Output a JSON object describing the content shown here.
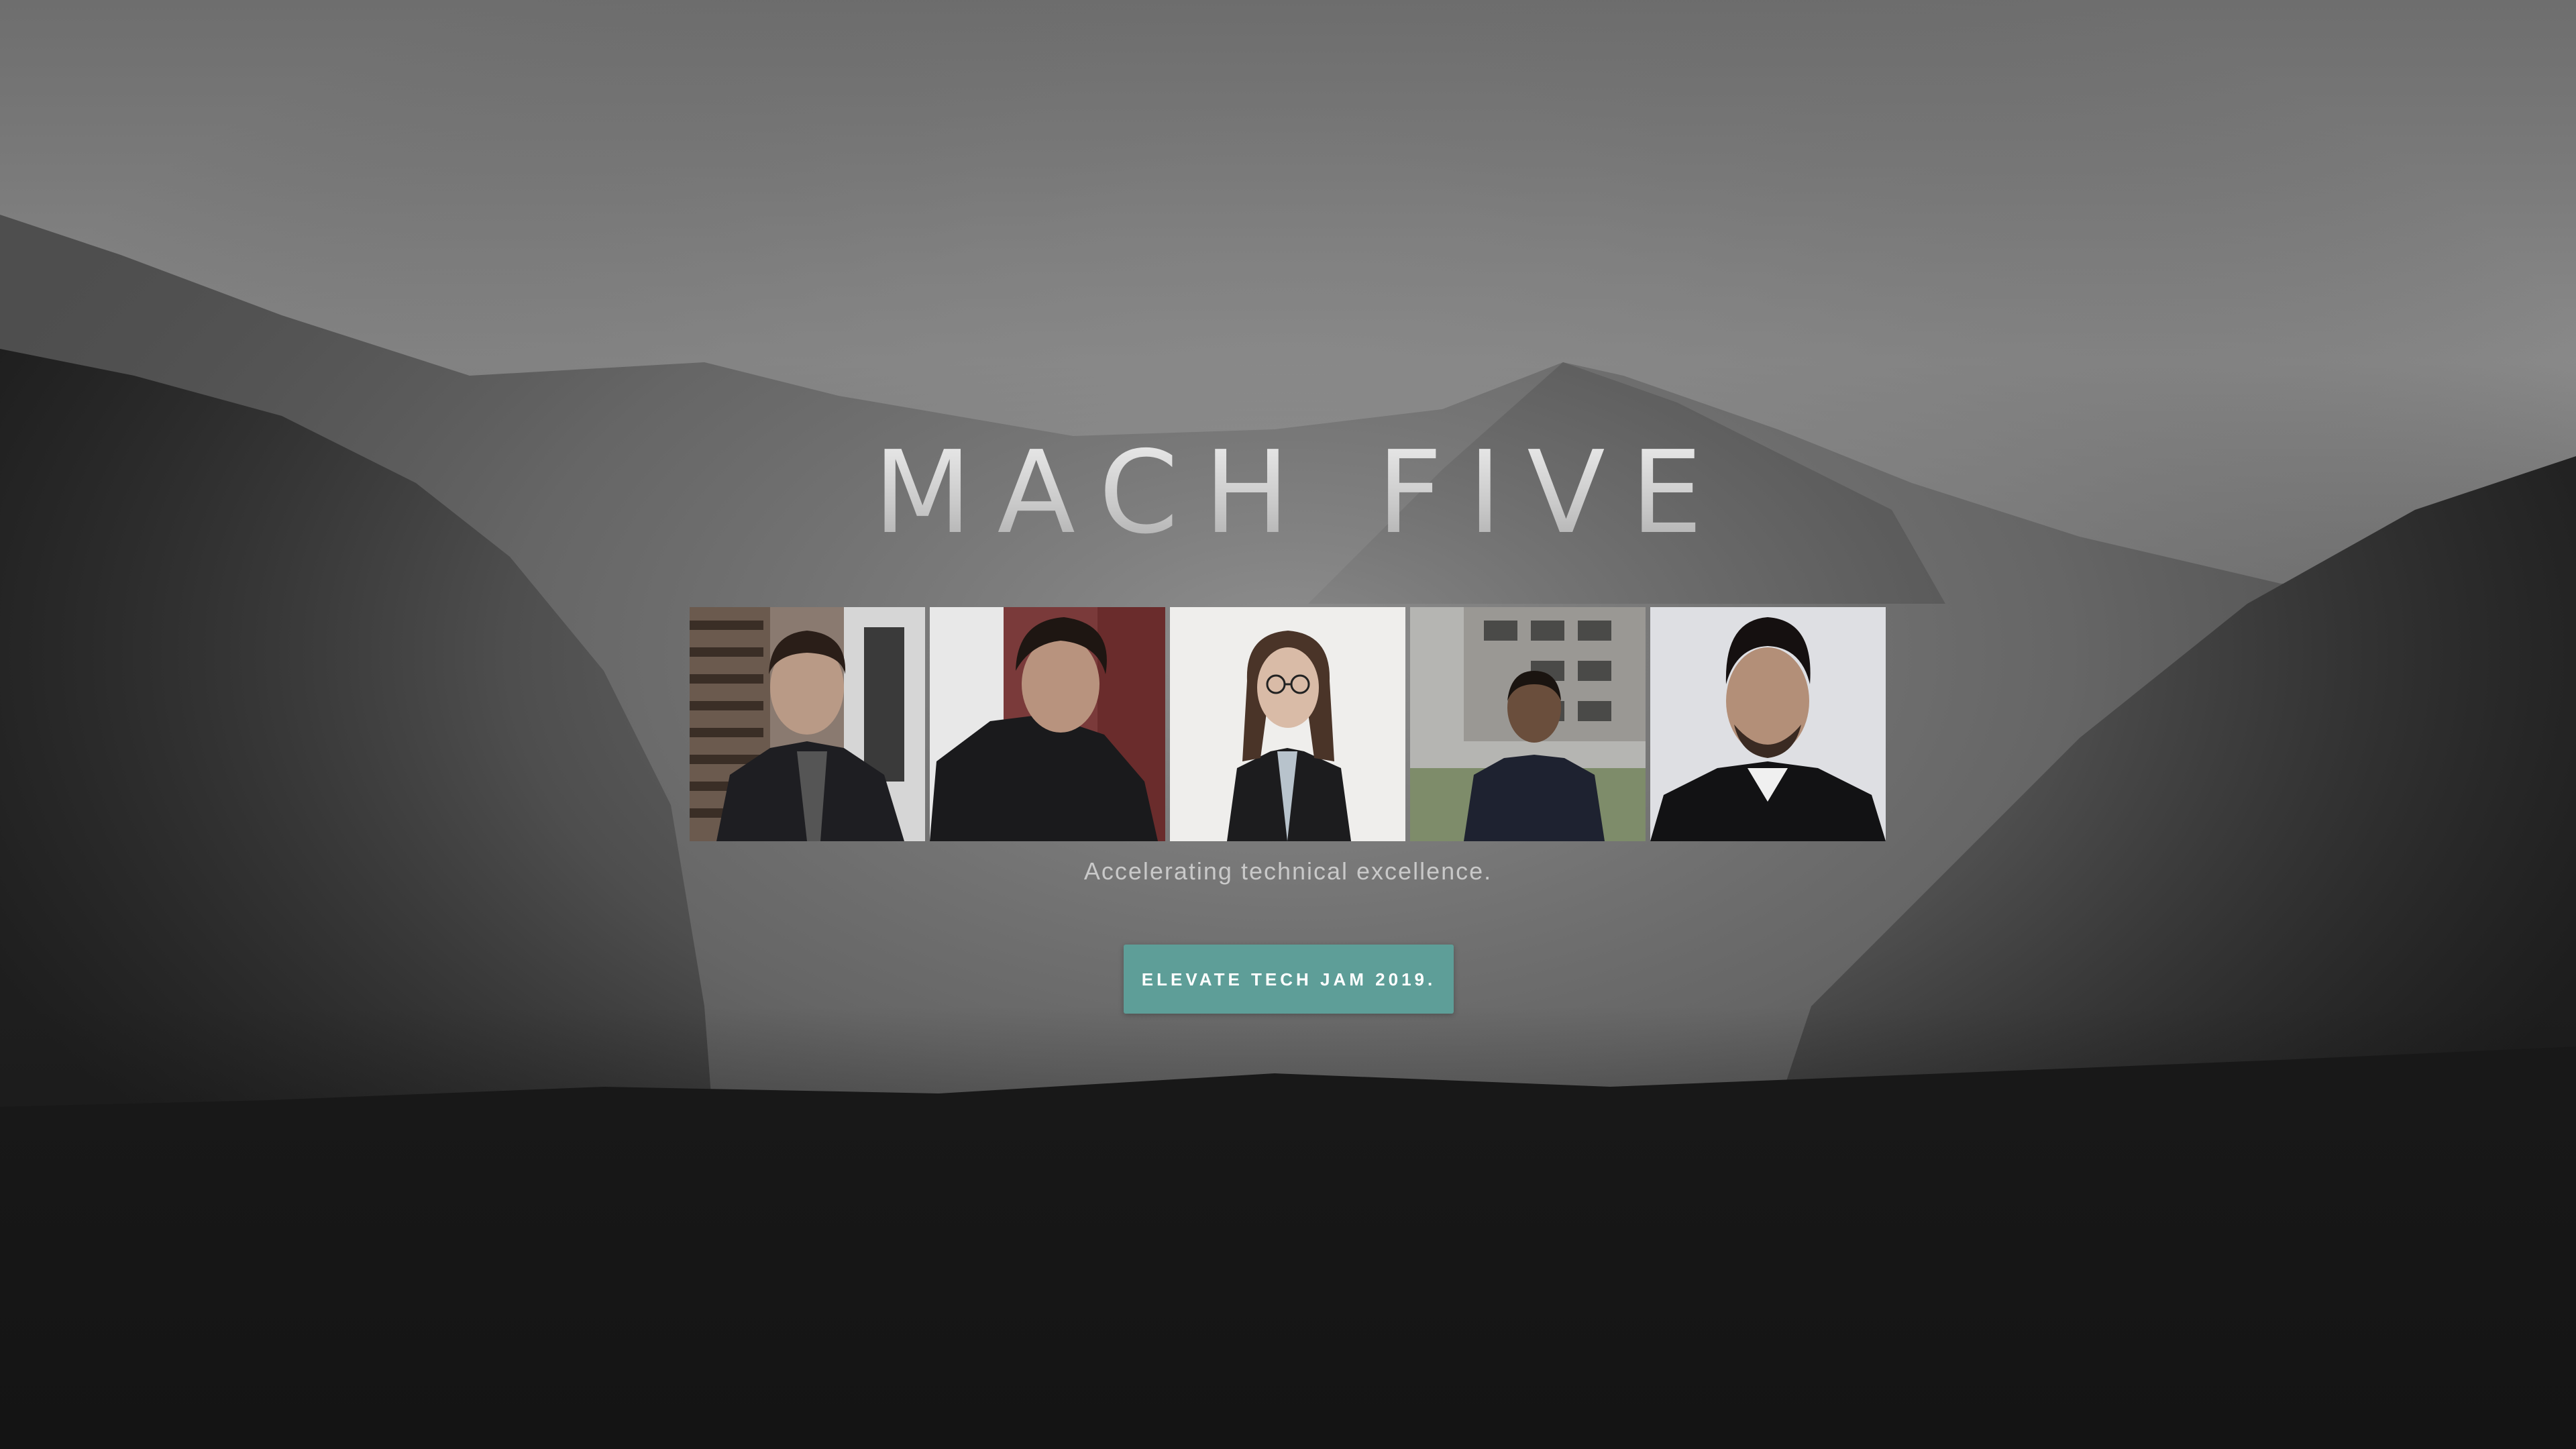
{
  "hero": {
    "title": "MACH FIVE",
    "tagline": "Accelerating technical excellence.",
    "cta_label": "ELEVATE TECH JAM 2019."
  },
  "team": [
    {
      "photo": "team-member-photo-1"
    },
    {
      "photo": "team-member-photo-2"
    },
    {
      "photo": "team-member-photo-3"
    },
    {
      "photo": "team-member-photo-4"
    },
    {
      "photo": "team-member-photo-5"
    }
  ],
  "colors": {
    "accent": "#5e9e98",
    "background_dark": "#141414",
    "text_light": "#c9c9c9"
  }
}
